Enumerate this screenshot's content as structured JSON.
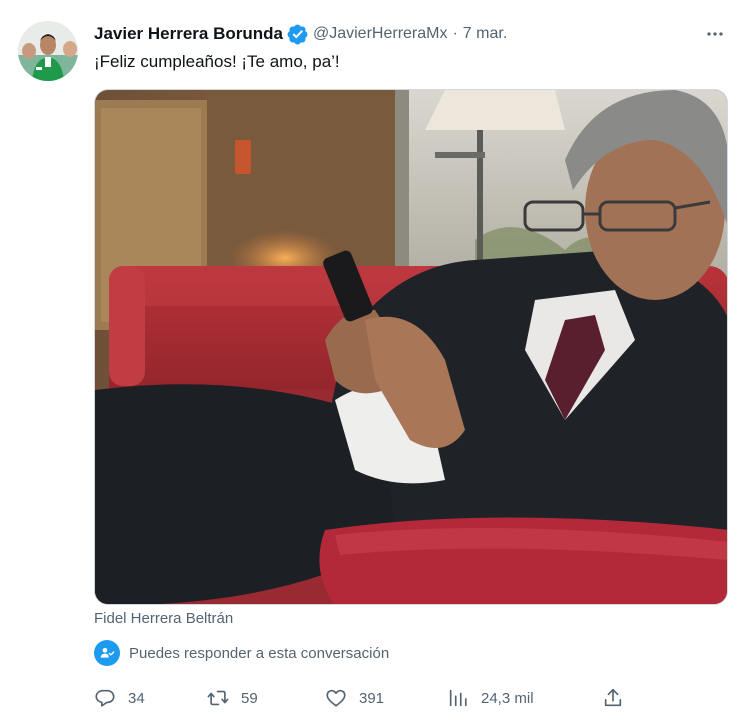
{
  "author": {
    "display_name": "Javier Herrera Borunda",
    "handle": "@JavierHerreraMx",
    "separator": "·",
    "date": "7 mar.",
    "avatar_icon": "profile-photo",
    "verified_icon": "verified-badge-icon",
    "verified_color": "#1d9bf0"
  },
  "tweet": {
    "text": "¡Feliz cumpleaños! ¡Te amo, pa’!",
    "media_caption": "Fidel Herrera Beltrán"
  },
  "reply_notice": {
    "text": "Puedes responder a esta conversación",
    "icon": "person-check-icon"
  },
  "actions": {
    "replies": {
      "icon": "reply-bubble-icon",
      "count": "34"
    },
    "retweets": {
      "icon": "retweet-icon",
      "count": "59"
    },
    "likes": {
      "icon": "heart-icon",
      "count": "391"
    },
    "views": {
      "icon": "views-bar-chart-icon",
      "count": "24,3 mil"
    },
    "share": {
      "icon": "share-upload-icon"
    }
  },
  "colors": {
    "text_primary": "#0f1419",
    "text_secondary": "#536471",
    "accent": "#1d9bf0",
    "border": "#cfd9de"
  }
}
